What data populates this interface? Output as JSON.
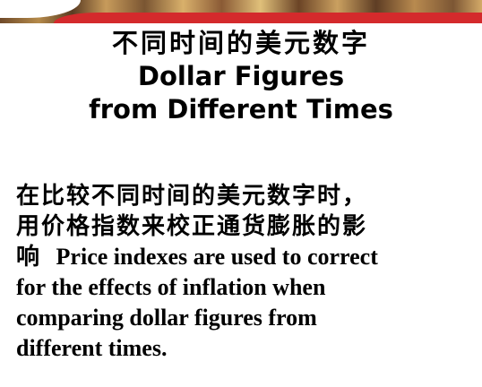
{
  "slide": {
    "title": {
      "line_cn": "不同时间的美元数字",
      "line_en_1": "Dollar Figures",
      "line_en_2": "from Different Times"
    },
    "body": {
      "cn_line_1": "在比较不同时间的美元数字时，",
      "cn_line_2": "用价格指数来校正通货膨胀的影",
      "cn_line_3": "响",
      "en_line_1": "Price indexes are used to correct",
      "en_line_2": "for the effects of inflation when",
      "en_line_3": "comparing dollar figures from",
      "en_line_4": "different times."
    }
  },
  "colors": {
    "banner_red": "#d42a2c",
    "text": "#000000",
    "background": "#ffffff"
  }
}
